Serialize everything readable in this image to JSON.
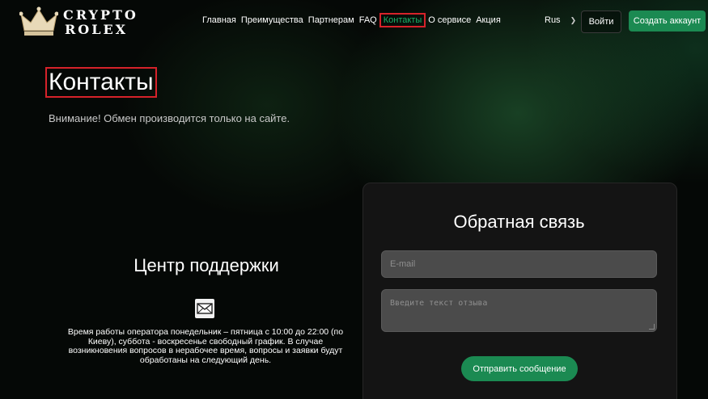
{
  "header": {
    "logo_line1": "CRYPTO",
    "logo_line2": "ROLEX",
    "nav": [
      "Главная",
      "Преимущества",
      "Партнерам",
      "FAQ",
      "Контакты",
      "О сервисе",
      "Акция"
    ],
    "active_nav": "Контакты",
    "language": "Rus",
    "login_label": "Войти",
    "signup_label": "Создать аккаунт"
  },
  "main": {
    "title": "Контакты",
    "notice": "Внимание! Обмен производится только на сайте."
  },
  "support": {
    "title": "Центр поддержки",
    "icon": "envelope-icon",
    "text": "Время работы оператора понедельник – пятница с 10:00 до 22:00 (по Киеву), суббота - воскресенье свободный график. В случае возникновения вопросов в нерабочее время, вопросы и заявки будут обработаны на следующий день."
  },
  "feedback": {
    "title": "Обратная связь",
    "email_placeholder": "E-mail",
    "message_placeholder": "Введите текст отзыва",
    "send_label": "Отправить сообщение"
  },
  "colors": {
    "accent": "#1b8a52",
    "active_nav_text": "#1bb36a",
    "highlight_outline": "#d6222a"
  }
}
